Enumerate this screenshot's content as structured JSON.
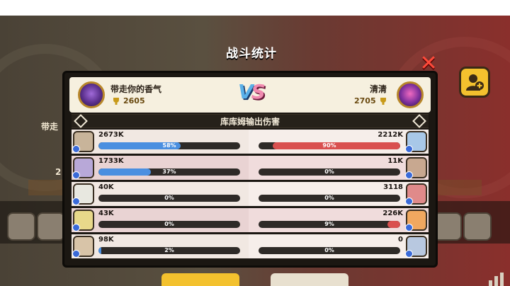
{
  "title": "战斗统计",
  "close_symbol": "✕",
  "section_title": "库库姆输出伤害",
  "vs_text": [
    "V",
    "S"
  ],
  "colors": {
    "left_bar": "#4a8fe0",
    "right_bar": "#d9504f"
  },
  "player_left": {
    "name": "带走你的香气",
    "trophies": "2605",
    "icon": "purple-cookie-avatar"
  },
  "player_right": {
    "name": "清清",
    "trophies": "2705",
    "icon": "pink-cookie-avatar"
  },
  "background": {
    "left_name_fragment": "带走",
    "left_count_fragment": "2"
  },
  "rows": [
    {
      "left": {
        "value": "2673K",
        "percent_label": "58%",
        "percent": 58,
        "icon": "tan-cookie-avatar"
      },
      "right": {
        "value": "2212K",
        "percent_label": "90%",
        "percent": 90,
        "icon": "blue-cookie-avatar"
      }
    },
    {
      "left": {
        "value": "1733K",
        "percent_label": "37%",
        "percent": 37,
        "icon": "lavender-cookie-avatar"
      },
      "right": {
        "value": "11K",
        "percent_label": "0%",
        "percent": 0,
        "icon": "brown-cookie-avatar"
      }
    },
    {
      "left": {
        "value": "40K",
        "percent_label": "0%",
        "percent": 0,
        "icon": "panda-cookie-avatar"
      },
      "right": {
        "value": "3118",
        "percent_label": "0%",
        "percent": 0,
        "icon": "red-cookie-avatar"
      }
    },
    {
      "left": {
        "value": "43K",
        "percent_label": "0%",
        "percent": 0,
        "icon": "yellow-flower-cookie-avatar"
      },
      "right": {
        "value": "226K",
        "percent_label": "9%",
        "percent": 9,
        "icon": "orange-cookie-avatar"
      }
    },
    {
      "left": {
        "value": "98K",
        "percent_label": "2%",
        "percent": 2,
        "icon": "pale-cookie-avatar"
      },
      "right": {
        "value": "0",
        "percent_label": "0%",
        "percent": 0,
        "icon": "skull-cookie-avatar"
      }
    }
  ]
}
